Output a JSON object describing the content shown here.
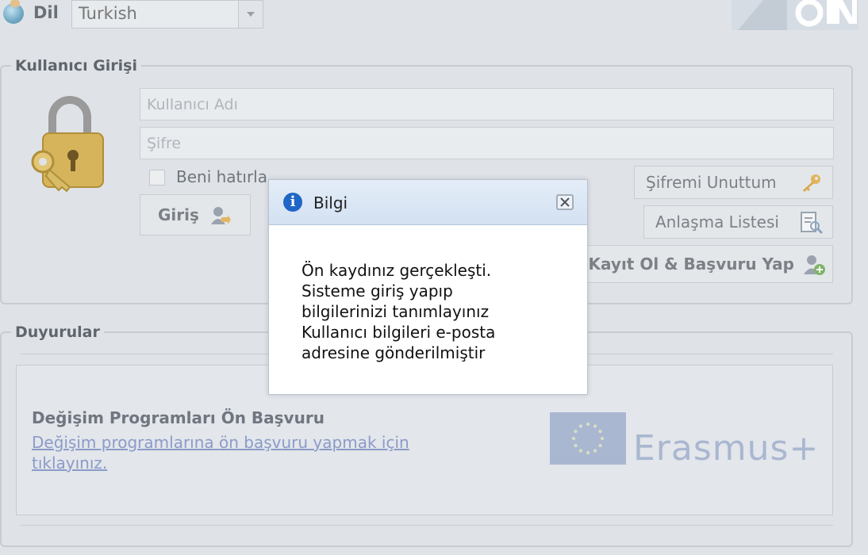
{
  "header": {
    "language_label": "Dil",
    "language_value": "Turkish"
  },
  "login": {
    "legend": "Kullanıcı Girişi",
    "username_placeholder": "Kullanıcı Adı",
    "password_placeholder": "Şifre",
    "remember_label": "Beni hatırla",
    "login_button": "Giriş",
    "forgot_button": "Şifremi Unuttum",
    "agreement_button": "Anlaşma Listesi",
    "register_button": "Kayıt Ol & Başvuru Yap"
  },
  "news": {
    "legend": "Duyurular",
    "item_title": "Değişim Programları Ön Başvuru",
    "item_link": "Değişim programlarına ön başvuru yapmak için tıklayınız.",
    "partner_logo_text": "Erasmus+"
  },
  "dialog": {
    "title": "Bilgi",
    "lines": [
      "Ön kaydınız gerçekleşti.",
      "Sisteme giriş yapıp",
      "bilgilerinizi tanımlayınız",
      "Kullanıcı bilgileri e-posta",
      "adresine gönderilmiştir"
    ]
  },
  "colors": {
    "dialog_header": "#d9e5f4",
    "info_icon": "#1f66c7",
    "overlay_bg": "#dfe3e8"
  },
  "icons": [
    "globe-icon",
    "lock-key-icon",
    "user-arrow-icon",
    "key-icon",
    "document-search-icon",
    "add-user-icon",
    "info-icon",
    "close-icon"
  ]
}
